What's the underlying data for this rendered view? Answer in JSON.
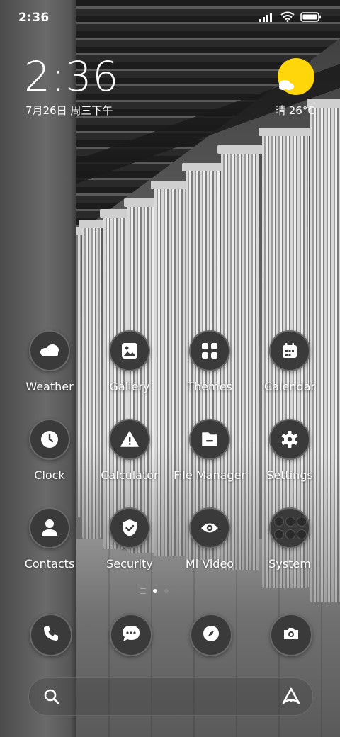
{
  "status_bar": {
    "time": "2:36",
    "icons": [
      "signal-icon",
      "wifi-icon",
      "battery-icon"
    ]
  },
  "lock_clock": {
    "time": "2:36",
    "date": "7月26日 周三下午"
  },
  "weather_widget": {
    "icon": "sun-cloud-icon",
    "text": "晴 26°C"
  },
  "apps": [
    {
      "label": "Weather",
      "icon": "weather-cloud-icon"
    },
    {
      "label": "Gallery",
      "icon": "gallery-icon"
    },
    {
      "label": "Themes",
      "icon": "themes-grid-icon"
    },
    {
      "label": "Calendar",
      "icon": "calendar-icon"
    },
    {
      "label": "Clock",
      "icon": "clock-icon"
    },
    {
      "label": "Calculator",
      "icon": "warning-triangle-icon"
    },
    {
      "label": "File Manager",
      "icon": "folder-icon"
    },
    {
      "label": "Settings",
      "icon": "gear-icon"
    },
    {
      "label": "Contacts",
      "icon": "person-icon"
    },
    {
      "label": "Security",
      "icon": "shield-check-icon"
    },
    {
      "label": "Mi Video",
      "icon": "eye-icon"
    },
    {
      "label": "System",
      "icon": "folder-grid-icon"
    }
  ],
  "page_indicator": {
    "pages": 2,
    "current": 1
  },
  "dock": [
    {
      "icon": "phone-icon"
    },
    {
      "icon": "message-icon"
    },
    {
      "icon": "compass-icon"
    },
    {
      "icon": "camera-icon"
    }
  ],
  "search": {
    "icon": "search-icon",
    "assistant_icon": "app-vault-icon"
  },
  "colors": {
    "sun": "#FFD60A",
    "icon_bg": "#3A3A3A",
    "icon_border": "#6A6A6A"
  }
}
